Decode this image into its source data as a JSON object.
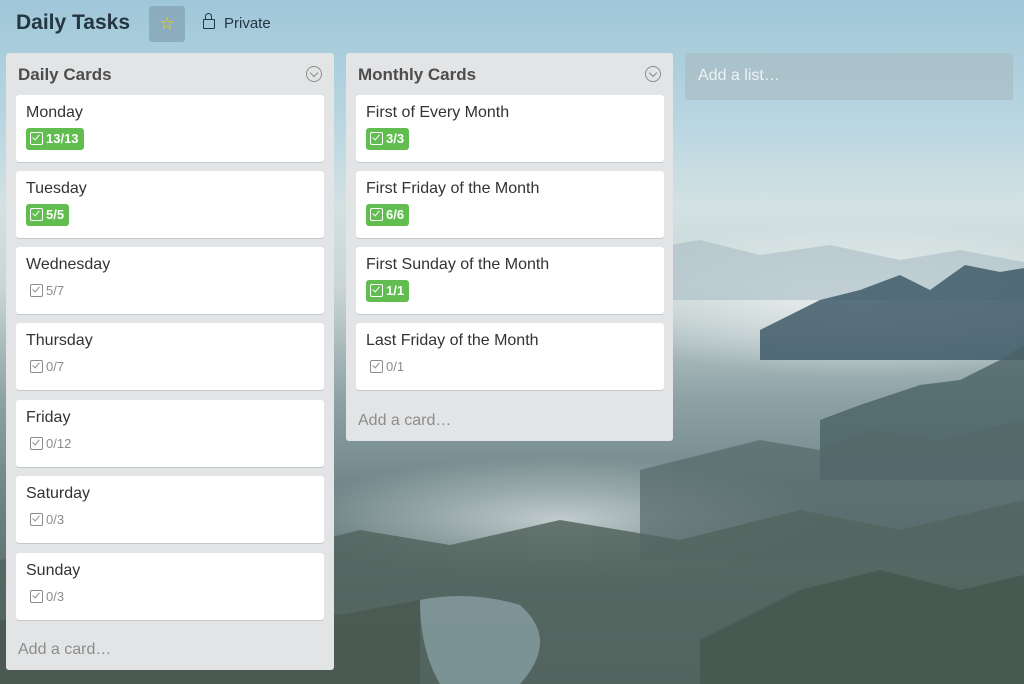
{
  "board": {
    "title": "Daily Tasks",
    "visibility": "Private",
    "star_color": "#f5d400"
  },
  "icons": {
    "star": "star-icon",
    "lock": "lock-icon",
    "menu": "chevron-down-circle-icon",
    "checklist": "checklist-icon"
  },
  "colors": {
    "complete_badge": "#61bd4f",
    "list_bg": "#e2e4e6"
  },
  "lists": [
    {
      "name": "Daily Cards",
      "add_card": "Add a card…",
      "cards": [
        {
          "title": "Monday",
          "checklist": "13/13",
          "complete": true
        },
        {
          "title": "Tuesday",
          "checklist": "5/5",
          "complete": true
        },
        {
          "title": "Wednesday",
          "checklist": "5/7",
          "complete": false
        },
        {
          "title": "Thursday",
          "checklist": "0/7",
          "complete": false
        },
        {
          "title": "Friday",
          "checklist": "0/12",
          "complete": false
        },
        {
          "title": "Saturday",
          "checklist": "0/3",
          "complete": false
        },
        {
          "title": "Sunday",
          "checklist": "0/3",
          "complete": false
        }
      ]
    },
    {
      "name": "Monthly Cards",
      "add_card": "Add a card…",
      "cards": [
        {
          "title": "First of Every Month",
          "checklist": "3/3",
          "complete": true
        },
        {
          "title": "First Friday of the Month",
          "checklist": "6/6",
          "complete": true
        },
        {
          "title": "First Sunday of the Month",
          "checklist": "1/1",
          "complete": true
        },
        {
          "title": "Last Friday of the Month",
          "checklist": "0/1",
          "complete": false
        }
      ]
    }
  ],
  "add_list": "Add a list…"
}
